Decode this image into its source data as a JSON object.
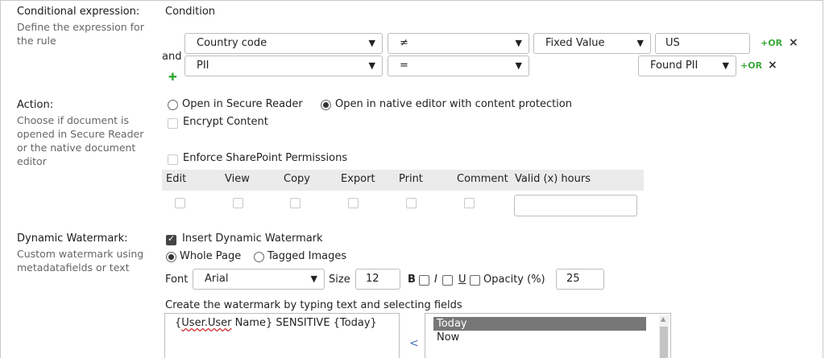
{
  "conditional": {
    "title": "Conditional expression:",
    "desc": "Define the expression for the rule",
    "condition_header": "Condition",
    "and_label": "and",
    "row1": {
      "field": "Country code",
      "operator": "≠",
      "value_type": "Fixed Value",
      "value": "US",
      "or_label": "+OR",
      "remove": "×"
    },
    "row2": {
      "field": "PII",
      "operator": "=",
      "value_type": "Found PII",
      "or_label": "+OR",
      "remove": "×"
    },
    "add_icon": "plus-icon"
  },
  "action": {
    "title": "Action:",
    "desc": "Choose if document is opened in Secure Reader or the native document editor",
    "radio_secure": "Open in Secure Reader",
    "radio_native": "Open in native editor with content protection",
    "selected": "native",
    "encrypt": "Encrypt Content",
    "enforce": "Enforce SharePoint Permissions",
    "columns": [
      "Edit",
      "View",
      "Copy",
      "Export",
      "Print",
      "Comment",
      "Valid (x) hours"
    ],
    "valid_hours": ""
  },
  "watermark": {
    "title": "Dynamic Watermark:",
    "desc": "Custom watermark using metadatafields or text",
    "insert": "Insert Dynamic Watermark",
    "insert_checked": true,
    "radio_whole": "Whole Page",
    "radio_tagged": "Tagged Images",
    "selected": "whole",
    "font_label": "Font",
    "font_value": "Arial",
    "size_label": "Size",
    "size_value": "12",
    "bold_label": "B",
    "italic_label": "I",
    "underline_label": "U",
    "opacity_label": "Opacity (%)",
    "opacity_value": "25",
    "create_label": "Create the watermark by typing text and selecting fields",
    "text_field": "User.User",
    "text_rest": " Name} SENSITIVE {Today}",
    "text_prefix": "{",
    "fields": [
      "Today",
      "Now"
    ],
    "selected_field": "Today",
    "insert_arrow": "<"
  }
}
